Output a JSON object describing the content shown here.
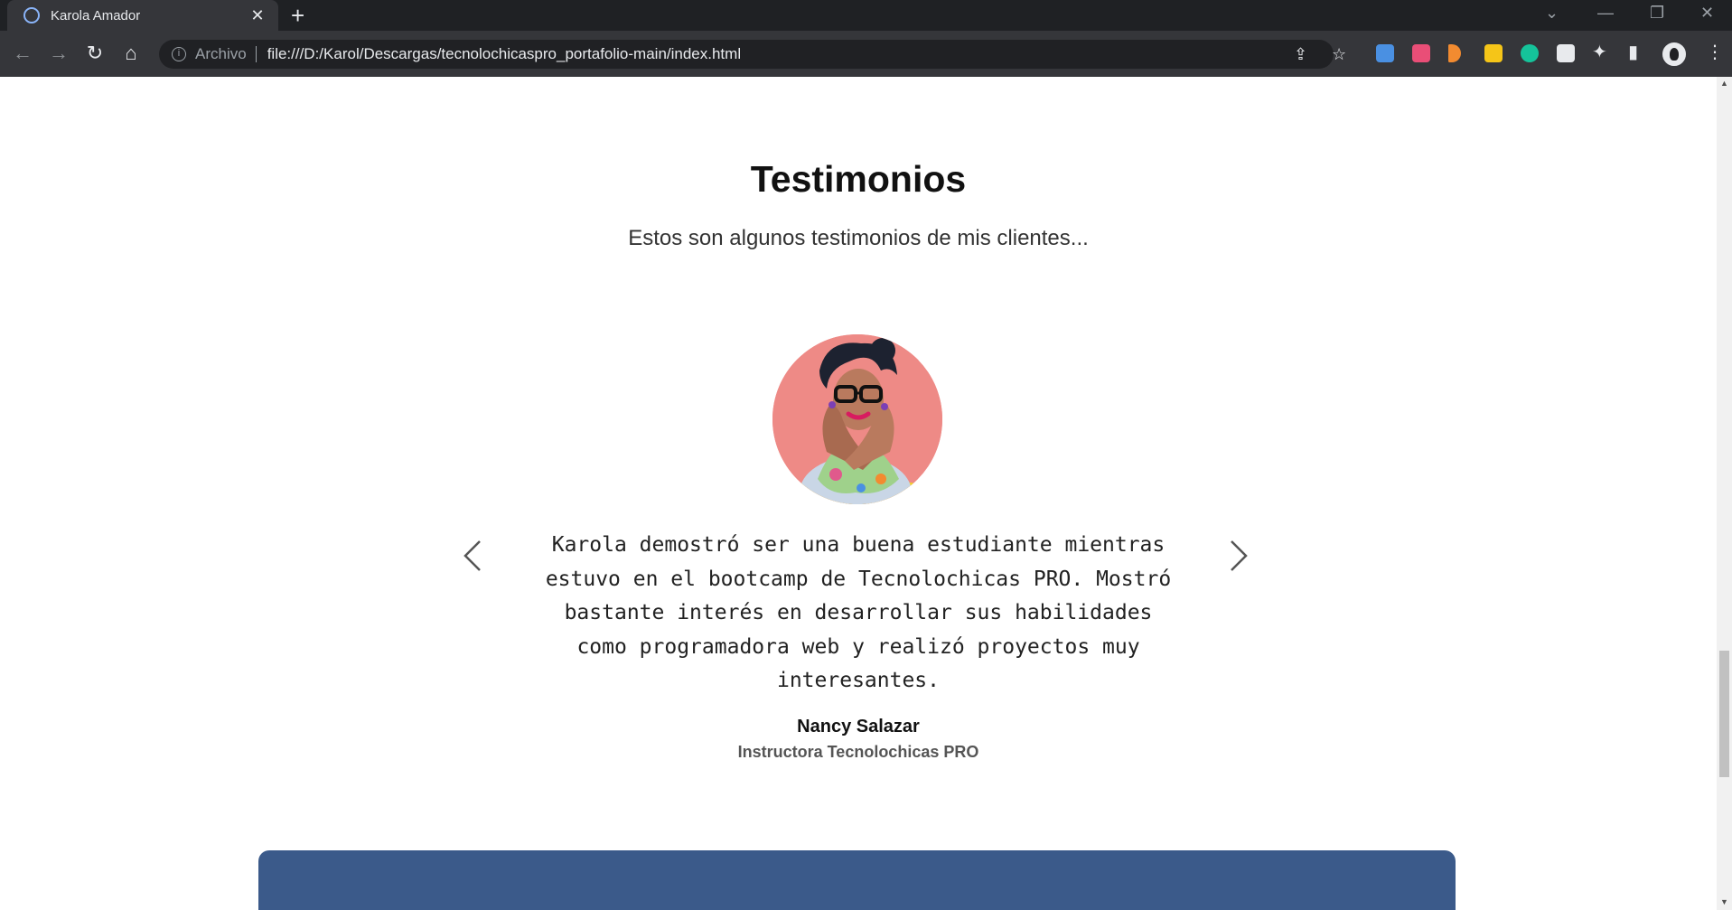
{
  "browser": {
    "tab_title": "Karola Amador",
    "tab_close": "✕",
    "new_tab": "+",
    "url_scheme": "Archivo",
    "url": "file:///D:/Karol/Descargas/tecnolochicaspro_portafolio-main/index.html",
    "icons": [
      "back-icon",
      "forward-icon",
      "reload-icon",
      "home-icon",
      "info-icon",
      "share-icon",
      "bookmark-star-icon",
      "extensions-icon",
      "side-panel-icon",
      "profile-icon",
      "menu-icon"
    ]
  },
  "testimonials": {
    "title": "Testimonios",
    "subtitle": "Estos son algunos testimonios de mis clientes...",
    "quote": "Karola demostró ser una buena estudiante mientras estuvo en el bootcamp de Tecnolochicas PRO. Mostró bastante interés en desarrollar sus habilidades como programadora web y realizó proyectos muy interesantes.",
    "author": "Nancy Salazar",
    "role": "Instructora Tecnolochicas PRO"
  },
  "colors": {
    "panel": "#3b5a8a",
    "photo_bg": "#ee8a86"
  }
}
